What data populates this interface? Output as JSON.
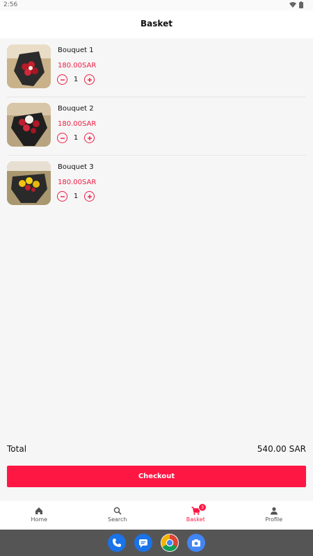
{
  "status_bar": {
    "time": "2:56"
  },
  "header": {
    "title": "Basket"
  },
  "basket": {
    "items": [
      {
        "name": "Bouquet 1",
        "price": "180.00SAR",
        "quantity": "1"
      },
      {
        "name": "Bouquet 2",
        "price": "180.00SAR",
        "quantity": "1"
      },
      {
        "name": "Bouquet 3",
        "price": "180.00SAR",
        "quantity": "1"
      }
    ]
  },
  "summary": {
    "total_label": "Total",
    "total_value": "540.00 SAR"
  },
  "checkout": {
    "label": "Checkout"
  },
  "bottom_nav": {
    "items": [
      {
        "label": "Home",
        "icon": "home-icon"
      },
      {
        "label": "Search",
        "icon": "search-icon"
      },
      {
        "label": "Basket",
        "icon": "cart-icon",
        "badge": "3"
      },
      {
        "label": "Profile",
        "icon": "person-icon"
      }
    ]
  },
  "dock": {
    "apps": [
      "phone-icon",
      "messages-icon",
      "chrome-icon",
      "camera-icon"
    ]
  },
  "colors": {
    "accent": "#ff1744",
    "price": "#ef1c44"
  }
}
